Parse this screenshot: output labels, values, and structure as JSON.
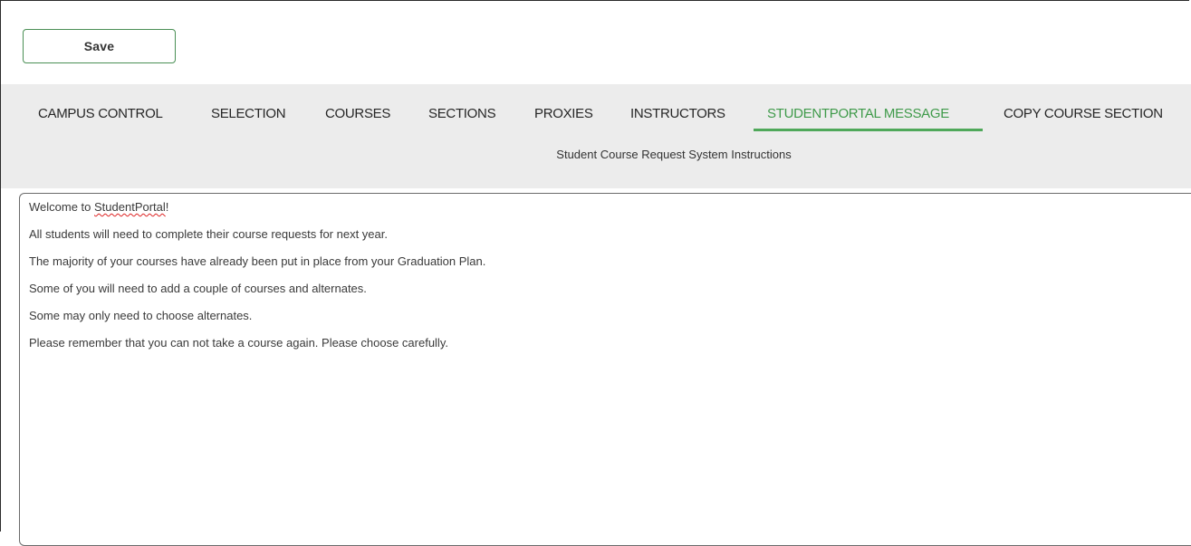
{
  "toolbar": {
    "save_label": "Save"
  },
  "tabs": [
    {
      "label": "CAMPUS CONTROL",
      "active": false
    },
    {
      "label": "SELECTION",
      "active": false
    },
    {
      "label": "COURSES",
      "active": false
    },
    {
      "label": "SECTIONS",
      "active": false
    },
    {
      "label": "PROXIES",
      "active": false
    },
    {
      "label": "INSTRUCTORS",
      "active": false
    },
    {
      "label": "STUDENTPORTAL MESSAGE",
      "active": true
    },
    {
      "label": "COPY COURSE SECTION",
      "active": false
    }
  ],
  "subtitle": "Student Course Request System Instructions",
  "message": {
    "line1_prefix": "Welcome to ",
    "line1_spell": "StudentPortal",
    "line1_suffix": "!",
    "lines": [
      "All students will need to complete their course requests for next year.",
      "The majority of your courses have already been put in place from your Graduation Plan.",
      "Some of you will need to add a couple of courses and alternates.",
      "Some may only need to choose alternates.",
      "Please remember that you can not take a course again. Please choose carefully."
    ]
  },
  "colors": {
    "accent": "#3f9a4a",
    "tab_background": "#ececec",
    "save_border": "#4a8f55"
  }
}
